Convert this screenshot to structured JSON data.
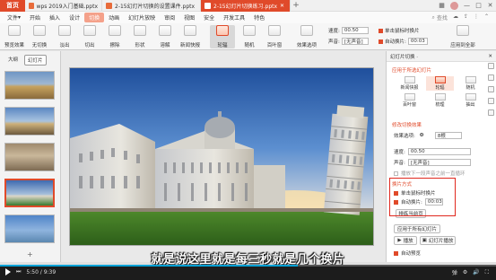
{
  "tabs": {
    "home": "首页",
    "docs": [
      {
        "label": "wps 2019入门基础.pptx",
        "active": false
      },
      {
        "label": "2-15幻灯片切换的设置课件.pptx",
        "active": false
      },
      {
        "label": "2-15幻灯片切换练习.pptx",
        "active": true
      }
    ],
    "plus": "+"
  },
  "menubar": {
    "file": "文件",
    "items": [
      "开始",
      "插入",
      "设计",
      "切换",
      "动画",
      "幻灯片放映",
      "审阅",
      "视图",
      "安全",
      "开发工具",
      "特色"
    ],
    "active_index": 3,
    "search": "查找"
  },
  "ribbon": {
    "preview": "预览效果",
    "effects": [
      "无切换",
      "淡出",
      "切出",
      "擦除",
      "形状",
      "溶解",
      "新闻快报",
      "轮辐",
      "随机",
      "百叶窗"
    ],
    "selected_effect": "轮辐",
    "effect_options": "效果选项",
    "sound_label": "声音:",
    "sound_value": "[无声音]",
    "speed_label": "速度:",
    "speed_value": "00.50",
    "on_click": "单击鼠标时换片",
    "auto_advance": "自动换片:",
    "auto_value": "00:03",
    "apply_all": "应用到全部"
  },
  "left_panel": {
    "tabs": [
      "大纲",
      "幻灯片"
    ],
    "active_tab": 1,
    "thumb_count": 5,
    "selected_index": 3
  },
  "right_pane": {
    "header": "幻灯片切换 ·",
    "section_apply": "应用于所选幻灯片",
    "effects": [
      "新闻快报",
      "轮辐",
      "随机",
      "百叶窗",
      "梳理",
      "抽出"
    ],
    "selected_effect": "轮辐",
    "section_modify": "修改切换效果",
    "effect_options_label": "效果选项:",
    "effect_options_value": "8根",
    "speed_label": "速度:",
    "speed_value": "00.50",
    "sound_label": "声音:",
    "sound_value": "[无声音]",
    "loop_sound": "播放下一段声音之前一直循环",
    "section_advance": "换片方式",
    "on_click": "单击鼠标时换片",
    "auto_advance": "自动换片:",
    "auto_value": "00:03",
    "rehearse": "排练当前页",
    "apply_all": "应用于所有幻灯片",
    "play": "播放",
    "slideshow": "幻灯片播放",
    "auto_preview": "自动预览"
  },
  "subtitle": "就是说这里就是每三秒就是几个换片",
  "video": {
    "time": "5:50 / 9:39",
    "progress": 0.6
  },
  "colors": {
    "accent": "#e04a2a",
    "highlight_box": "#e0281e",
    "progress": "#00a1d6"
  }
}
